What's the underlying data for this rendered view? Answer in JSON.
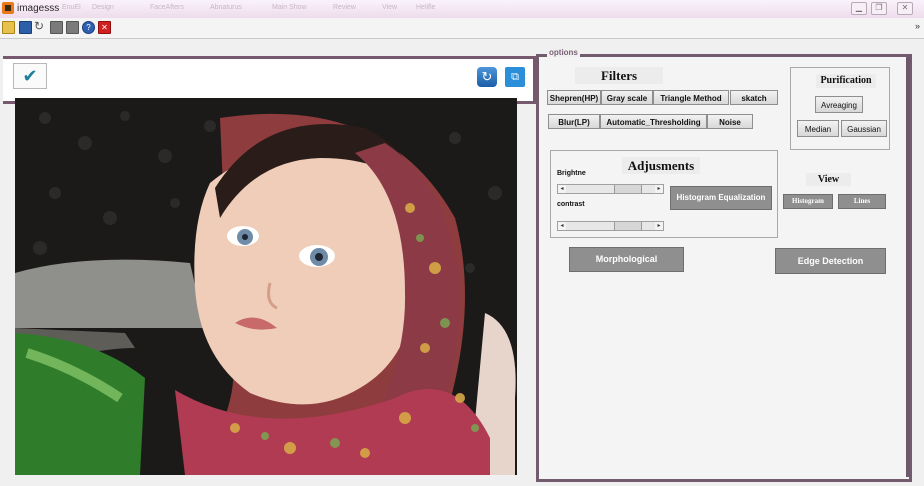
{
  "window": {
    "title": "imagesss",
    "ghost_menu": [
      "EnuEl",
      "Design",
      "FaceAfters",
      "Abnaturus",
      "Main Show",
      "Review",
      "View",
      "Helifle"
    ],
    "controls": [
      "minimize-icon",
      "restore-icon",
      "close-icon"
    ]
  },
  "toolbar": {
    "icons": [
      "open-icon",
      "save-icon",
      "refresh-icon",
      "grid-icon",
      "grid-icon",
      "help-icon",
      "close-icon"
    ],
    "overflow": "»"
  },
  "image_panel": {
    "apply_icon": "check-icon",
    "rotate_icon": "rotate-icon",
    "crop_icon": "crop-icon"
  },
  "options": {
    "label": "options",
    "filters": {
      "heading": "Filters",
      "row1": [
        "Shepren(HP)",
        "Gray scale",
        "Triangle Method",
        "skatch"
      ],
      "row2": [
        "Blur(LP)",
        "Automatic_Thresholding",
        "Noise"
      ]
    },
    "purification": {
      "heading": "Purification",
      "averaging": "Avreaging",
      "median": "Median",
      "gaussian": "Gaussian"
    },
    "adjustments": {
      "heading": "Adjusments",
      "brightness_label": "Brightne",
      "contrast_label": "contrast",
      "histogram_equalization": "Histogram Equalization"
    },
    "view": {
      "heading": "View",
      "histogram": "Histogram",
      "lines": "Lines"
    },
    "morphological": "Morphological",
    "edge_detection": "Edge Detection"
  },
  "colors": {
    "frame_accent": "#715b6d",
    "button_dark": "#8f8f8f"
  }
}
